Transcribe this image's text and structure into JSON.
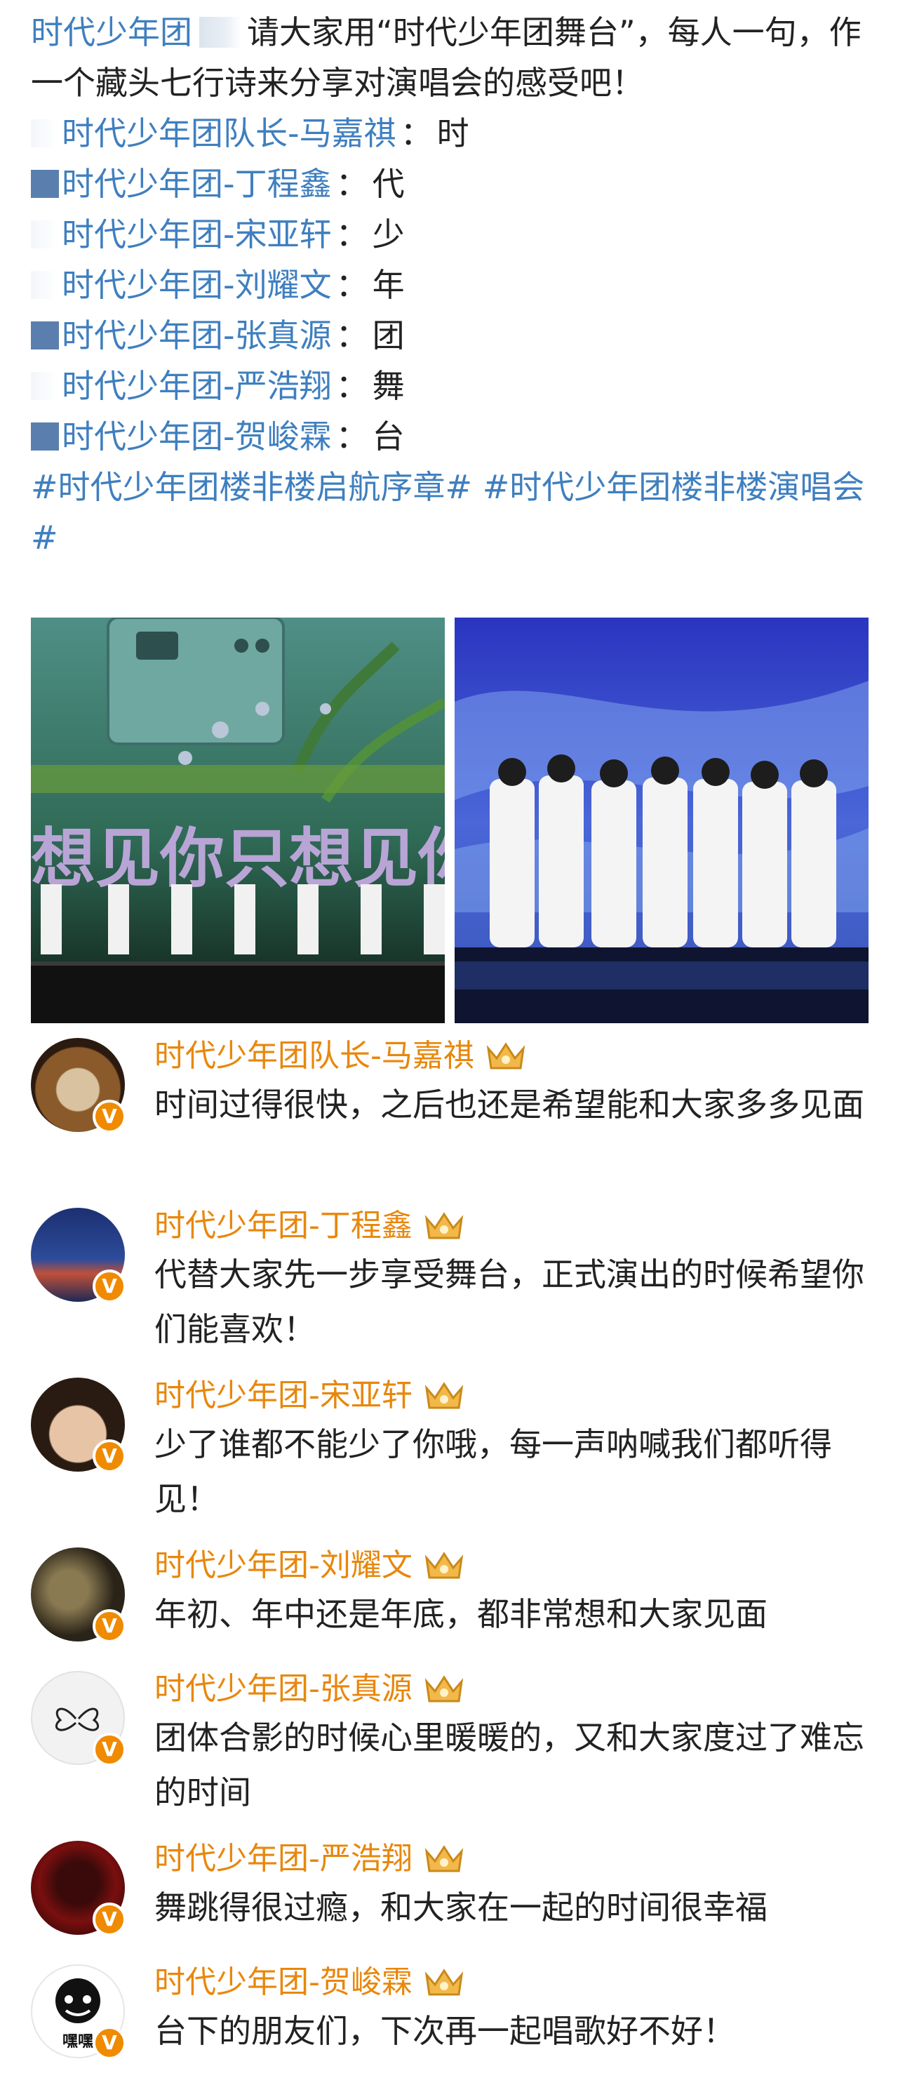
{
  "post": {
    "author_mention": "时代少年团",
    "intro_text": "请大家用“时代少年团舞台”，每人一句，作一个藏头七行诗来分享对演唱会的感受吧！",
    "lines": [
      {
        "name": "时代少年团队长-马嘉祺",
        "sep": "：",
        "char": "时",
        "mark": "faint"
      },
      {
        "name": "时代少年团-丁程鑫",
        "sep": "：",
        "char": "代",
        "mark": "solid"
      },
      {
        "name": "时代少年团-宋亚轩",
        "sep": "：",
        "char": "少",
        "mark": "faint"
      },
      {
        "name": "时代少年团-刘耀文",
        "sep": "：",
        "char": "年",
        "mark": "faint"
      },
      {
        "name": "时代少年团-张真源",
        "sep": "：",
        "char": "团",
        "mark": "solid"
      },
      {
        "name": "时代少年团-严浩翔",
        "sep": "：",
        "char": "舞",
        "mark": "faint"
      },
      {
        "name": "时代少年团-贺峻霖",
        "sep": "：",
        "char": "台",
        "mark": "solid"
      }
    ],
    "hashtags": "#时代少年团楼非楼启航序章# #时代少年团楼非楼演唱会#",
    "photo1_text": "想见你只想见你"
  },
  "comments": [
    {
      "name": "时代少年团队长-马嘉祺",
      "text": "时间过得很快，之后也还是希望能和大家多多见面",
      "avatar": "dog"
    },
    {
      "name": "时代少年团-丁程鑫",
      "text": "代替大家先一步享受舞台，正式演出的时候希望你们能喜欢！",
      "avatar": "sky"
    },
    {
      "name": "时代少年团-宋亚轩",
      "text": "少了谁都不能少了你哦，每一声呐喊我们都听得见！",
      "avatar": "face"
    },
    {
      "name": "时代少年团-刘耀文",
      "text": "年初、年中还是年底，都非常想和大家见面",
      "avatar": "dark"
    },
    {
      "name": "时代少年团-张真源",
      "text": "团体合影的时候心里暖暖的，又和大家度过了难忘的时间",
      "avatar": "butterfly"
    },
    {
      "name": "时代少年团-严浩翔",
      "text": "舞跳得很过瘾，和大家在一起的时间很幸福",
      "avatar": "red"
    },
    {
      "name": "时代少年团-贺峻霖",
      "text": "台下的朋友们，下次再一起唱歌好不好！",
      "avatar": "meme",
      "avatar_label": "嘿嘿"
    }
  ],
  "verified_badge": "V",
  "colors": {
    "link": "#3f7fbf",
    "username": "#e8870c",
    "badge": "#f08a00"
  }
}
